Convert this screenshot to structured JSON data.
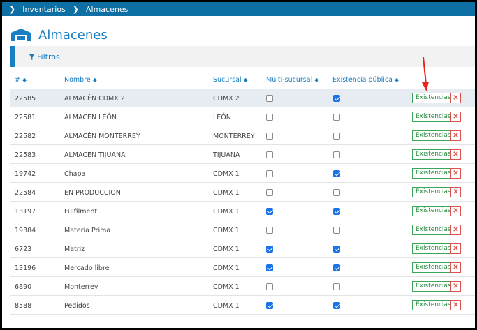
{
  "breadcrumb": [
    "Inventarios",
    "Almacenes"
  ],
  "page": {
    "title": "Almacenes"
  },
  "filters": {
    "label": "Filtros"
  },
  "columns": {
    "id": "#",
    "name": "Nombre",
    "branch": "Sucursal",
    "multi": "Multi-sucursal",
    "public": "Existencia pública"
  },
  "actions": {
    "existencias": "Existencias",
    "delete": "✕"
  },
  "colors": {
    "accent": "#1a7ec2",
    "topbar": "#0d6fa3",
    "success": "#3aa657",
    "danger": "#d9534f",
    "annotation": "#e8241a"
  },
  "rows": [
    {
      "id": "22585",
      "name": "ALMACÉN CDMX 2",
      "branch": "CDMX 2",
      "multi": false,
      "public": true,
      "highlight": true
    },
    {
      "id": "22581",
      "name": "ALMACEN LEÓN",
      "branch": "LEÓN",
      "multi": false,
      "public": false
    },
    {
      "id": "22582",
      "name": "ALMACÉN MONTERREY",
      "branch": "MONTERREY",
      "multi": false,
      "public": false
    },
    {
      "id": "22583",
      "name": "ALMACÉN TIJUANA",
      "branch": "TIJUANA",
      "multi": false,
      "public": false
    },
    {
      "id": "19742",
      "name": "Chapa",
      "branch": "CDMX 1",
      "multi": false,
      "public": true
    },
    {
      "id": "22584",
      "name": "EN PRODUCCION",
      "branch": "CDMX 1",
      "multi": false,
      "public": false
    },
    {
      "id": "13197",
      "name": "Fulfilment",
      "branch": "CDMX 1",
      "multi": true,
      "public": true
    },
    {
      "id": "19384",
      "name": "Materia Prima",
      "branch": "CDMX 1",
      "multi": false,
      "public": false
    },
    {
      "id": "6723",
      "name": "Matriz",
      "branch": "CDMX 1",
      "multi": true,
      "public": true
    },
    {
      "id": "13196",
      "name": "Mercado libre",
      "branch": "CDMX 1",
      "multi": true,
      "public": true
    },
    {
      "id": "6890",
      "name": "Monterrey",
      "branch": "CDMX 1",
      "multi": false,
      "public": false
    },
    {
      "id": "8588",
      "name": "Pedidos",
      "branch": "CDMX 1",
      "multi": true,
      "public": true
    }
  ]
}
